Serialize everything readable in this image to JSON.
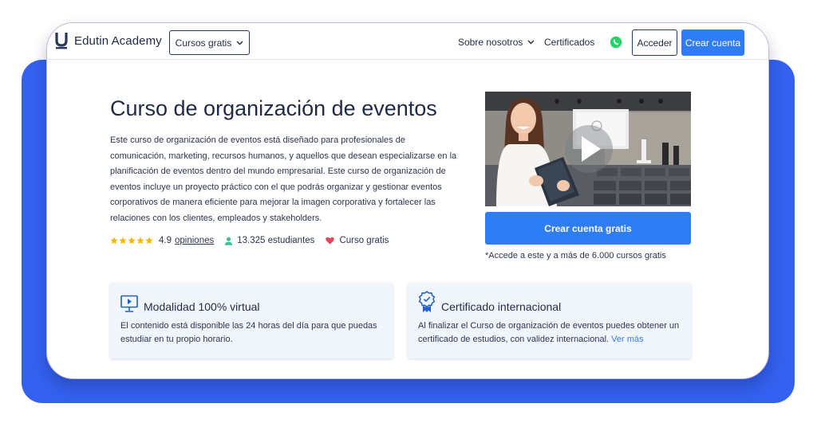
{
  "header": {
    "logo_text": "Edutin Academy",
    "courses_label": "Cursos gratis",
    "about_label": "Sobre nosotros",
    "certificates_label": "Certificados",
    "login_label": "Acceder",
    "signup_label": "Crear cuenta"
  },
  "hero": {
    "title": "Curso de organización de eventos",
    "description": "Este curso de organización de eventos está diseñado para profesionales de comunicación, marketing, recursos humanos, y aquellos que desean especializarse en la planificación de eventos dentro del mundo empresarial. Este curso de organización de eventos incluye un proyecto práctico con el que podrás organizar y gestionar eventos corporativos de manera eficiente para mejorar la imagen corporativa y fortalecer las relaciones con los clientes, empleados y stakeholders.",
    "rating": "4.9",
    "rating_stars": 5,
    "reviews_label": "opiniones",
    "students": "13.325 estudiantes",
    "free_label": "Curso gratis",
    "cta_label": "Crear cuenta gratis",
    "cta_note": "*Accede a este y a más de 6.000 cursos gratis"
  },
  "cards": [
    {
      "icon": "video-monitor-icon",
      "title": "Modalidad 100% virtual",
      "text": "El contenido está disponible las 24 horas del día para que puedas estudiar en tu propio horario."
    },
    {
      "icon": "certificate-badge-icon",
      "title": "Certificado internacional",
      "text": "Al finalizar el Curso de organización de eventos puedes obtener un certificado de estudios, con validez internacional.",
      "link_label": "Ver más"
    }
  ],
  "colors": {
    "accent": "#2f7df6",
    "backdrop": "#3461f0",
    "star": "#f5b800",
    "heart": "#e3475b",
    "user": "#3ec293",
    "whatsapp": "#25d366"
  }
}
